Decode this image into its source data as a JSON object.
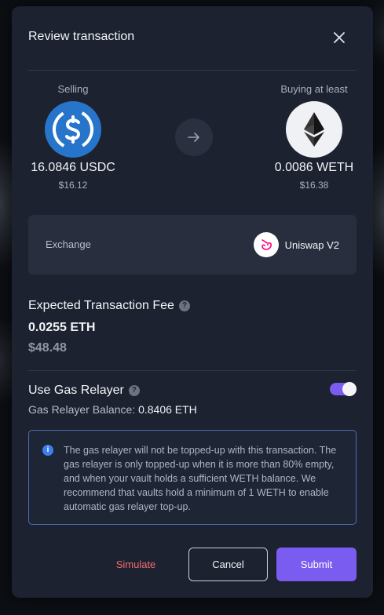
{
  "modal": {
    "title": "Review transaction",
    "close_icon": "close-icon"
  },
  "selling": {
    "label": "Selling",
    "token_icon": "usdc-icon",
    "amount": "16.0846 USDC",
    "usd": "$16.12",
    "color": "#2775ca"
  },
  "arrow_icon": "arrow-right-icon",
  "buying": {
    "label": "Buying at least",
    "token_icon": "ethereum-icon",
    "amount": "0.0086 WETH",
    "usd": "$16.38",
    "color": "#f0f1f5"
  },
  "exchange": {
    "label": "Exchange",
    "icon": "uniswap-icon",
    "name": "Uniswap V2"
  },
  "fee": {
    "title": "Expected Transaction Fee",
    "help_icon": "help-icon",
    "eth": "0.0255 ETH",
    "usd": "$48.48"
  },
  "relayer": {
    "title": "Use Gas Relayer",
    "help_icon": "help-icon",
    "balance_label": "Gas Relayer Balance:",
    "balance_value": "0.8406 ETH",
    "enabled": true
  },
  "info": {
    "icon": "info-icon",
    "text": "The gas relayer will not be topped-up with this transaction. The gas relayer is only topped-up when it is more than 80% empty, and when your vault holds a sufficient WETH balance. We recommend that vaults hold a minimum of 1 WETH to enable automatic gas relayer top-up."
  },
  "actions": {
    "simulate": "Simulate",
    "cancel": "Cancel",
    "submit": "Submit"
  },
  "colors": {
    "accent": "#7b5cf0",
    "danger": "#f26b6b",
    "info": "#3d7ef0"
  }
}
